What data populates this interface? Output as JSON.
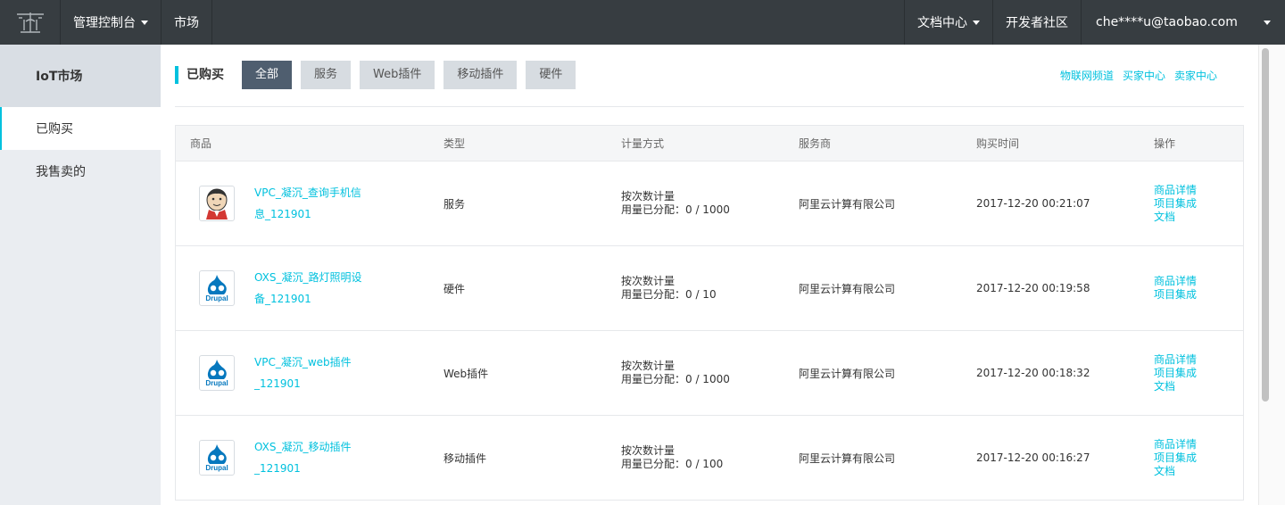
{
  "topbar": {
    "console": "管理控制台",
    "market": "市场",
    "docs": "文档中心",
    "community": "开发者社区",
    "user": "che****u@taobao.com"
  },
  "sidebar": {
    "title": "IoT市场",
    "items": [
      {
        "label": "已购买"
      },
      {
        "label": "我售卖的"
      }
    ]
  },
  "main": {
    "section_title": "已购买",
    "filters": [
      {
        "label": "全部"
      },
      {
        "label": "服务"
      },
      {
        "label": "Web插件"
      },
      {
        "label": "移动插件"
      },
      {
        "label": "硬件"
      }
    ],
    "quick_links": [
      {
        "label": "物联网频道"
      },
      {
        "label": "买家中心"
      },
      {
        "label": "卖家中心"
      }
    ],
    "table": {
      "headers": [
        "商品",
        "类型",
        "计量方式",
        "服务商",
        "购买时间",
        "操作"
      ],
      "rows": [
        {
          "name": "VPC_凝沉_查询手机信息_121901",
          "type": "服务",
          "metering1": "按次数计量",
          "metering2": "用量已分配：0 / 1000",
          "vendor": "阿里云计算有限公司",
          "time": "2017-12-20 00:21:07",
          "actions": [
            "商品详情",
            "项目集成",
            "文档"
          ],
          "icon": "jenkins-icon"
        },
        {
          "name": "OXS_凝沉_路灯照明设备_121901",
          "type": "硬件",
          "metering1": "按次数计量",
          "metering2": "用量已分配：0 / 10",
          "vendor": "阿里云计算有限公司",
          "time": "2017-12-20 00:19:58",
          "actions": [
            "商品详情",
            "项目集成"
          ],
          "icon": "drupal-icon"
        },
        {
          "name": "VPC_凝沉_web插件_121901",
          "type": "Web插件",
          "metering1": "按次数计量",
          "metering2": "用量已分配：0 / 1000",
          "vendor": "阿里云计算有限公司",
          "time": "2017-12-20 00:18:32",
          "actions": [
            "商品详情",
            "项目集成",
            "文档"
          ],
          "icon": "drupal-icon"
        },
        {
          "name": "OXS_凝沉_移动插件_121901",
          "type": "移动插件",
          "metering1": "按次数计量",
          "metering2": "用量已分配：0 / 100",
          "vendor": "阿里云计算有限公司",
          "time": "2017-12-20 00:16:27",
          "actions": [
            "商品详情",
            "项目集成",
            "文档"
          ],
          "icon": "drupal-icon"
        }
      ]
    }
  },
  "colors": {
    "topbar": "#373d41",
    "accent": "#00c1de",
    "sidebar": "#eaedf1",
    "filter_active": "#4f5e6f"
  }
}
